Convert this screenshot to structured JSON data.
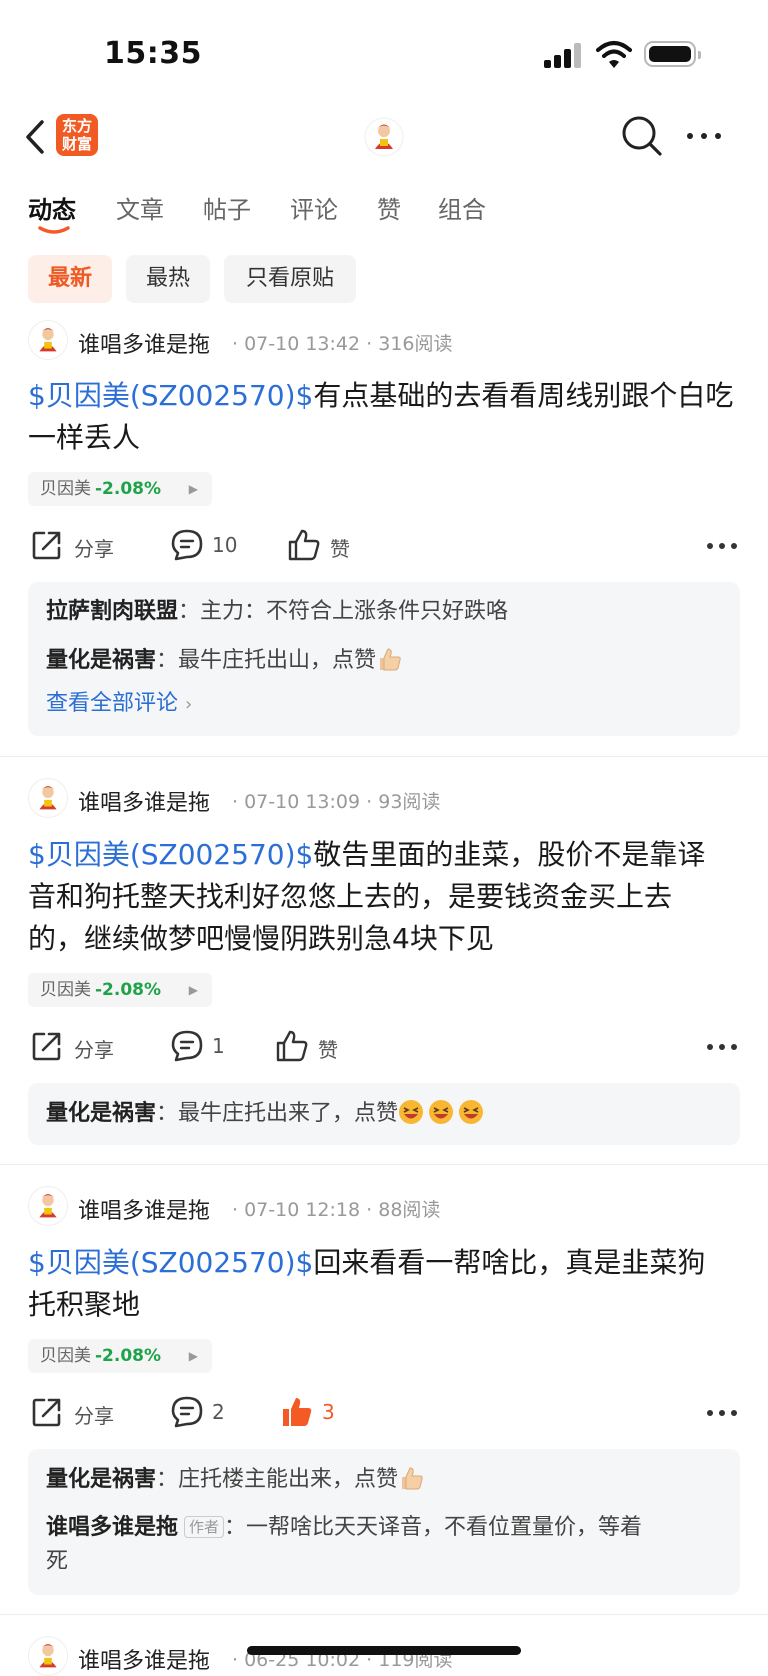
{
  "status_bar": {
    "time": "15:35"
  },
  "header": {
    "logo_line1": "东方",
    "logo_line2": "财富"
  },
  "tabs": [
    {
      "label": "动态"
    },
    {
      "label": "文章"
    },
    {
      "label": "帖子"
    },
    {
      "label": "评论"
    },
    {
      "label": "赞"
    },
    {
      "label": "组合"
    }
  ],
  "filters": [
    {
      "label": "最新"
    },
    {
      "label": "最热"
    },
    {
      "label": "只看原贴"
    }
  ],
  "colors": {
    "accent": "#f35a25",
    "link": "#2b6fd6",
    "down": "#1ea34a"
  },
  "posts": [
    {
      "user": "谁唱多谁是拖",
      "date": "07-10 13:42",
      "reads": "316阅读",
      "stock_link": "$贝因美(SZ002570)$",
      "text": "有点基础的去看看周线别跟个白吃一样丢人",
      "tag_name": "贝因美",
      "tag_change": "-2.08%",
      "share": "分享",
      "comments": "10",
      "likes": "赞",
      "liked": false,
      "comment_list": [
        {
          "user": "拉萨割肉联盟",
          "text": "主力：不符合上涨条件只好跌咯"
        },
        {
          "user": "量化是祸害",
          "text": "最牛庄托出山，点赞"
        }
      ],
      "view_all": "查看全部评论"
    },
    {
      "user": "谁唱多谁是拖",
      "date": "07-10 13:09",
      "reads": "93阅读",
      "stock_link": "$贝因美(SZ002570)$",
      "text_line1": "敬告里面的韭菜，股价不是靠译",
      "text_line2": "音和狗托整天找利好忽悠上去的，是要钱资金买上去",
      "text_line3": "的，继续做梦吧慢慢阴跌别急4块下见",
      "tag_name": "贝因美",
      "tag_change": "-2.08%",
      "share": "分享",
      "comments": "1",
      "likes": "赞",
      "liked": false,
      "comment_list": [
        {
          "user": "量化是祸害",
          "text": "最牛庄托出来了，点赞"
        }
      ]
    },
    {
      "user": "谁唱多谁是拖",
      "date": "07-10 12:18",
      "reads": "88阅读",
      "stock_link": "$贝因美(SZ002570)$",
      "text_line1": "回来看看一帮啥比，真是韭菜狗",
      "text_line2": "托积聚地",
      "tag_name": "贝因美",
      "tag_change": "-2.08%",
      "share": "分享",
      "comments": "2",
      "likes": "3",
      "liked": true,
      "comment_list": [
        {
          "user": "量化是祸害",
          "text": "庄托楼主能出来，点赞"
        },
        {
          "user": "谁唱多谁是拖",
          "author_tag": "作者",
          "text_line1": "一帮啥比天天译音，不看位置量价，等着",
          "text_line2": "死"
        }
      ]
    },
    {
      "user": "谁唱多谁是拖",
      "date": "06-25 10:02",
      "reads": "119阅读"
    }
  ],
  "icons": {
    "back": "chevron-left-icon",
    "search": "search-icon",
    "more": "more-dots-icon",
    "share": "share-icon",
    "comment": "comment-icon",
    "like": "thumb-up-icon"
  }
}
